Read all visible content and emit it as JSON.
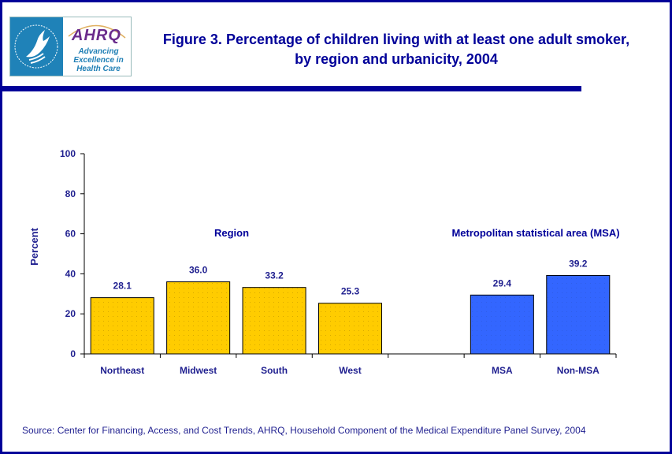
{
  "logo": {
    "org_name": "AHRQ",
    "tagline": "Advancing Excellence in Health Care",
    "seal_icon": "hhs-eagle-seal-icon"
  },
  "header": {
    "title": "Figure 3. Percentage of children living with at least one adult smoker, by region and urbanicity, 2004"
  },
  "colors": {
    "frame": "#000099",
    "region_bars": "#FFCC00",
    "msa_bars": "#3366FF",
    "text": "#1F1F8F"
  },
  "chart_data": {
    "type": "bar",
    "title": "Figure 3. Percentage of children living with at least one adult smoker, by region and urbanicity, 2004",
    "xlabel": "",
    "ylabel": "Percent",
    "ylim": [
      0,
      100
    ],
    "yticks": [
      0,
      20,
      40,
      60,
      80,
      100
    ],
    "grid": false,
    "legend": "none",
    "categories": [
      "Northeast",
      "Midwest",
      "South",
      "West",
      "",
      "MSA",
      "Non-MSA"
    ],
    "groups": [
      {
        "name": "Region",
        "categories": [
          "Northeast",
          "Midwest",
          "South",
          "West"
        ],
        "values": [
          28.1,
          36.0,
          33.2,
          25.3
        ],
        "value_labels": [
          "28.1",
          "36.0",
          "33.2",
          "25.3"
        ],
        "color": "#FFCC00"
      },
      {
        "name": "Metropolitan statistical area (MSA)",
        "categories": [
          "MSA",
          "Non-MSA"
        ],
        "values": [
          29.4,
          39.2
        ],
        "value_labels": [
          "29.4",
          "39.2"
        ],
        "color": "#3366FF"
      }
    ]
  },
  "footer": {
    "source": "Source: Center for Financing, Access, and Cost Trends, AHRQ, Household Component of the Medical Expenditure Panel Survey, 2004"
  }
}
